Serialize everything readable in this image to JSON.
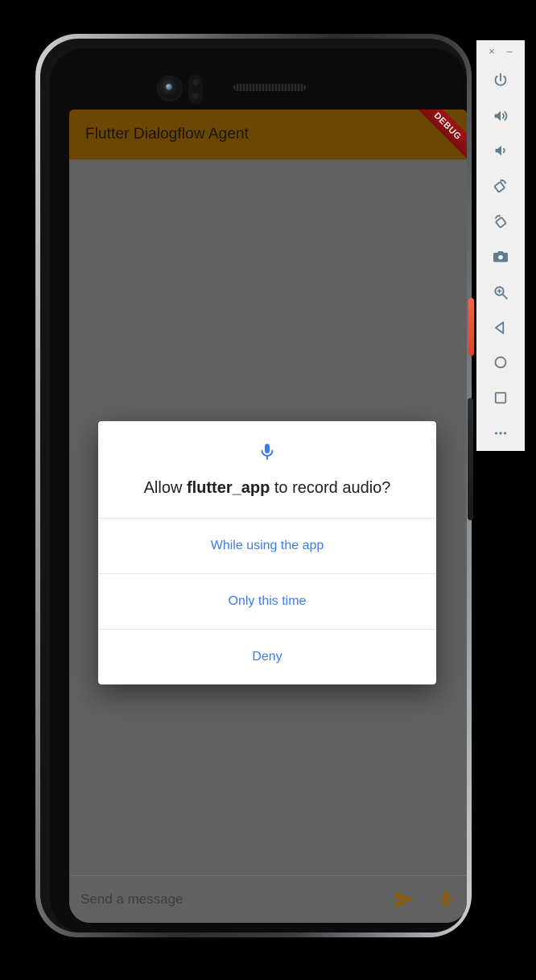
{
  "emulator": {
    "window_controls": [
      {
        "name": "close",
        "glyph": "×"
      },
      {
        "name": "minimize",
        "glyph": "–"
      }
    ],
    "buttons": [
      {
        "name": "power-icon",
        "label": "Power"
      },
      {
        "name": "volume-up-icon",
        "label": "Volume Up"
      },
      {
        "name": "volume-down-icon",
        "label": "Volume Down"
      },
      {
        "name": "rotate-left-icon",
        "label": "Rotate Left"
      },
      {
        "name": "rotate-right-icon",
        "label": "Rotate Right"
      },
      {
        "name": "screenshot-camera-icon",
        "label": "Take Screenshot"
      },
      {
        "name": "zoom-icon",
        "label": "Enter zoom mode"
      },
      {
        "name": "back-icon",
        "label": "Back"
      },
      {
        "name": "home-icon",
        "label": "Home"
      },
      {
        "name": "overview-icon",
        "label": "Overview"
      },
      {
        "name": "more-icon",
        "label": "More"
      }
    ]
  },
  "app": {
    "title": "Flutter Dialogflow Agent",
    "debug_banner": "DEBUG",
    "appbar_color": "#6b4703",
    "scrim_color": "#616161"
  },
  "dialog": {
    "icon": "microphone-icon",
    "icon_color": "#3b7ced",
    "prompt_prefix": "Allow ",
    "prompt_app": "flutter_app",
    "prompt_suffix": " to record audio?",
    "options": [
      {
        "id": "while-using-the-app",
        "label": "While using the app"
      },
      {
        "id": "only-this-time",
        "label": "Only this time"
      },
      {
        "id": "deny",
        "label": "Deny"
      }
    ]
  },
  "input_bar": {
    "placeholder": "Send a message",
    "send_icon": "send-icon",
    "mic_icon": "microphone-icon",
    "icon_color": "#8a5a05"
  }
}
